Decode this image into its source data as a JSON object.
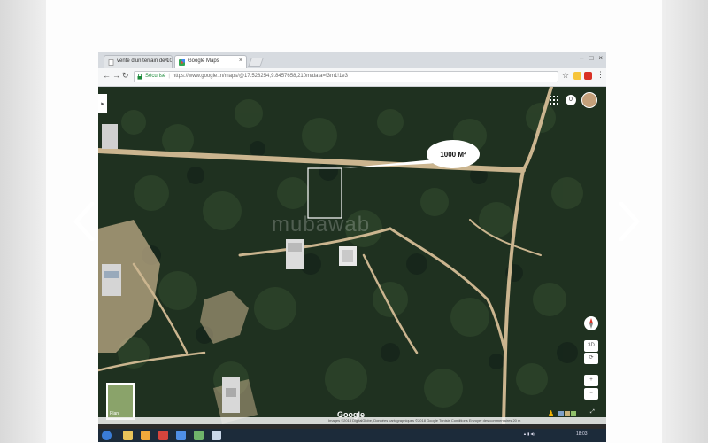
{
  "tabs": [
    {
      "label": "vente d'un terrain de 10",
      "icon": "page-icon"
    },
    {
      "label": "Google Maps",
      "icon": "google-maps-icon"
    }
  ],
  "address_bar": {
    "secure_label": "Sécurisé",
    "url": "https://www.google.tn/maps/@17.528254,9.8457658,210m/data=!3m1!1e3"
  },
  "map": {
    "callout_text": "1000 M²",
    "watermark": "mubawab",
    "plan_label": "Plan",
    "google_logo": "Google",
    "attribution": "Images ©2018 DigitalGlobe, Données cartographiques ©2018 Google   Tunisie   Conditions   Envoyer des commentaires   20 m",
    "notification_count": "0",
    "tilt_label": "3D",
    "zoom_in_label": "+",
    "zoom_out_label": "−"
  },
  "taskbar": {
    "clock": "18:03"
  },
  "colors": {
    "forest": "#1f3120",
    "sand": "#cbb58f",
    "chrome_tab_bar": "#d7dbe0",
    "secure_green": "#1b8a3a",
    "taskbar": "#1c2b3a"
  }
}
